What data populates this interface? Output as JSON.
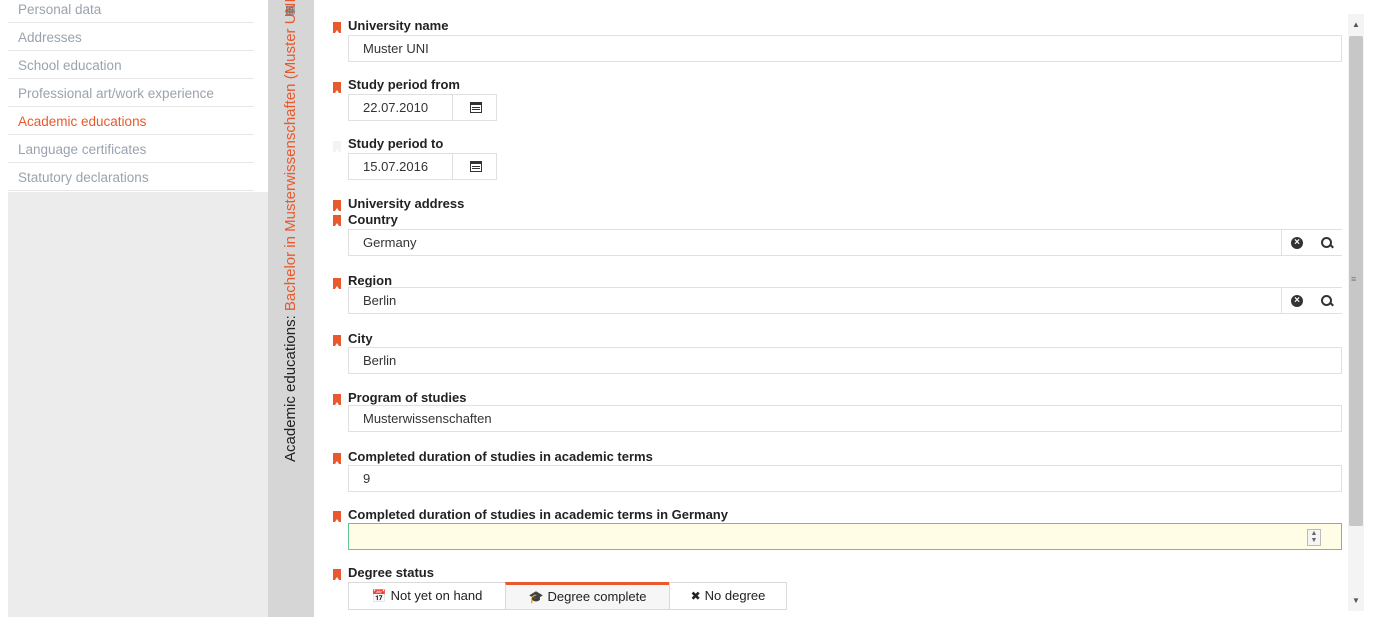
{
  "nav": {
    "items": [
      {
        "label": "Personal data",
        "active": false
      },
      {
        "label": "Addresses",
        "active": false
      },
      {
        "label": "School education",
        "active": false
      },
      {
        "label": "Professional art/work experience",
        "active": false
      },
      {
        "label": "Academic educations",
        "active": true
      },
      {
        "label": "Language certificates",
        "active": false
      },
      {
        "label": "Statutory declarations",
        "active": false
      }
    ]
  },
  "section": {
    "title_prefix": "Academic educations: ",
    "title_highlight": "Bachelor in Musterwissenschaften (Muster UNI)"
  },
  "form": {
    "university_name": {
      "label": "University name",
      "value": "Muster UNI",
      "required": true
    },
    "study_from": {
      "label": "Study period from",
      "value": "22.07.2010",
      "required": true
    },
    "study_to": {
      "label": "Study period to",
      "value": "15.07.2016",
      "required": false
    },
    "university_address": {
      "label": "University address",
      "required": true
    },
    "country": {
      "label": "Country",
      "value": "Germany",
      "required": true
    },
    "region": {
      "label": "Region",
      "value": "Berlin",
      "required": true
    },
    "city": {
      "label": "City",
      "value": "Berlin",
      "required": true
    },
    "program": {
      "label": "Program of studies",
      "value": "Musterwissenschaften",
      "required": true
    },
    "terms": {
      "label": "Completed duration of studies in academic terms",
      "value": "9",
      "required": true
    },
    "terms_germany": {
      "label": "Completed duration of studies in academic terms in Germany",
      "value": "",
      "required": true
    },
    "degree_status": {
      "label": "Degree status",
      "options": [
        {
          "label": "Not yet on hand",
          "icon": "calendar-icon",
          "selected": false
        },
        {
          "label": "Degree complete",
          "icon": "graduation-cap-icon",
          "selected": true
        },
        {
          "label": "No degree",
          "icon": "x-mark-icon",
          "selected": false
        }
      ]
    }
  },
  "colors": {
    "accent": "#e8592e",
    "active_field_bg": "#fffde5",
    "active_field_border": "#5fc49a"
  }
}
